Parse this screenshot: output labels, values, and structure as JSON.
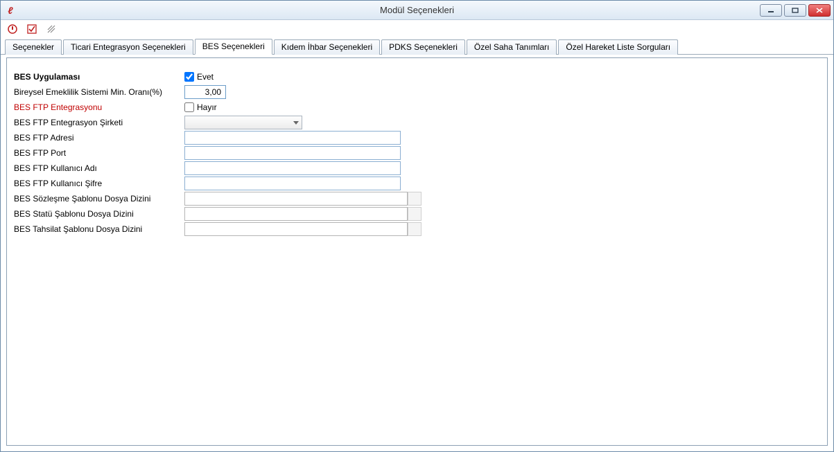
{
  "window": {
    "title": "Modül Seçenekleri"
  },
  "tabs": {
    "t0": "Seçenekler",
    "t1": "Ticari Entegrasyon Seçenekleri",
    "t2": "BES Seçenekleri",
    "t3": "Kıdem İhbar Seçenekleri",
    "t4": "PDKS Seçenekleri",
    "t5": "Özel Saha Tanımları",
    "t6": "Özel Hareket Liste Sorguları"
  },
  "labels": {
    "bes_uygulamasi": "BES Uygulaması",
    "bes_min_oran": "Bireysel Emeklilik Sistemi Min. Oranı(%)",
    "bes_ftp_ent": "BES FTP Entegrasyonu",
    "bes_ftp_sirket": "BES FTP Entegrasyon Şirketi",
    "bes_ftp_adres": "BES FTP Adresi",
    "bes_ftp_port": "BES FTP Port",
    "bes_ftp_user": "BES FTP Kullanıcı Adı",
    "bes_ftp_pass": "BES FTP Kullanıcı Şifre",
    "bes_sozlesme_dir": "BES Sözleşme Şablonu Dosya Dizini",
    "bes_statu_dir": "BES Statü Şablonu Dosya Dizini",
    "bes_tahsilat_dir": "BES Tahsilat Şablonu Dosya Dizini"
  },
  "values": {
    "evet": "Evet",
    "hayir": "Hayır",
    "min_oran": "3,00",
    "ftp_sirket": "",
    "ftp_adres": "",
    "ftp_port": "",
    "ftp_user": "",
    "ftp_pass": "",
    "sozlesme_dir": "",
    "statu_dir": "",
    "tahsilat_dir": ""
  }
}
